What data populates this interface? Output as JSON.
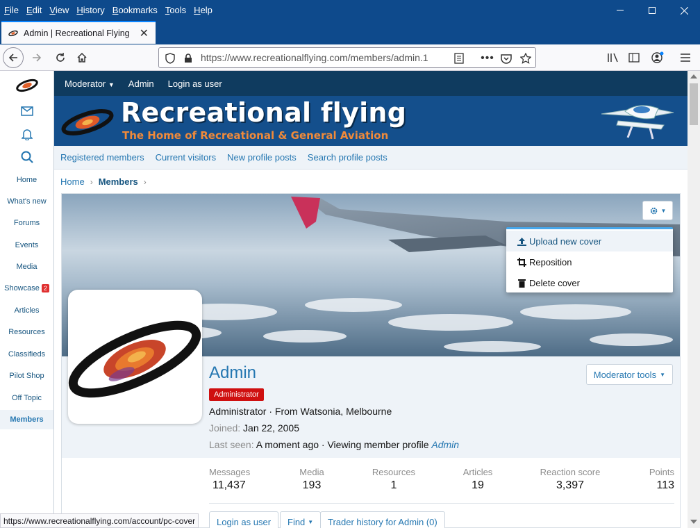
{
  "menubar": {
    "items": [
      "File",
      "Edit",
      "View",
      "History",
      "Bookmarks",
      "Tools",
      "Help"
    ]
  },
  "tab": {
    "title": "Admin | Recreational Flying"
  },
  "urlbar": {
    "host": "https://www.recreationalflying.com",
    "path": "/members/admin.1"
  },
  "sidebar": {
    "items": [
      {
        "label": "Home"
      },
      {
        "label": "What's new"
      },
      {
        "label": "Forums"
      },
      {
        "label": "Events"
      },
      {
        "label": "Media"
      },
      {
        "label": "Showcase",
        "badge": "2"
      },
      {
        "label": "Articles"
      },
      {
        "label": "Resources"
      },
      {
        "label": "Classifieds"
      },
      {
        "label": "Pilot Shop"
      },
      {
        "label": "Off Topic"
      },
      {
        "label": "Members"
      }
    ]
  },
  "topbar": {
    "moderator": "Moderator",
    "admin": "Admin",
    "login_as_user": "Login as user"
  },
  "banner": {
    "title": "Recreational flying",
    "subtitle": "The Home of Recreational & General Aviation"
  },
  "subnav": {
    "items": [
      "Registered members",
      "Current visitors",
      "New profile posts",
      "Search profile posts"
    ]
  },
  "breadcrumb": {
    "home": "Home",
    "members": "Members"
  },
  "cover_menu": {
    "upload": "Upload new cover",
    "reposition": "Reposition",
    "delete": "Delete cover"
  },
  "profile": {
    "name": "Admin",
    "badge": "Administrator",
    "title_line": "Administrator · From Watsonia, Melbourne",
    "joined_label": "Joined:",
    "joined_value": "Jan 22, 2005",
    "last_seen_label": "Last seen:",
    "last_seen_value": "A moment ago · Viewing member profile",
    "last_seen_link": "Admin",
    "moderator_tools": "Moderator tools"
  },
  "stats": [
    {
      "label": "Messages",
      "value": "11,437"
    },
    {
      "label": "Media",
      "value": "193"
    },
    {
      "label": "Resources",
      "value": "1"
    },
    {
      "label": "Articles",
      "value": "19"
    },
    {
      "label": "Reaction score",
      "value": "3,397"
    },
    {
      "label": "Points",
      "value": "113"
    }
  ],
  "actions": {
    "login_as_user": "Login as user",
    "find": "Find",
    "trader_history": "Trader history for Admin (0)"
  },
  "status_url": "https://www.recreationalflying.com/account/pc-cover",
  "colors": {
    "link": "#2577b1",
    "topbar": "#0f3b5f",
    "banner": "#144f8c",
    "badge": "#cf1010",
    "chrome": "#0e4a8c"
  }
}
